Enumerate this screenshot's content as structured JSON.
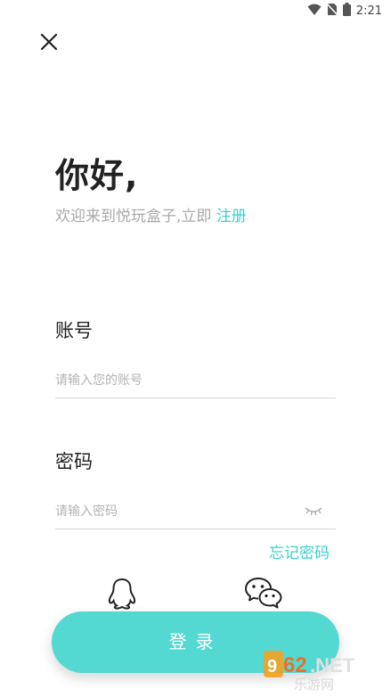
{
  "status_bar": {
    "time": "2:21",
    "icons": [
      "wifi-icon",
      "no-sim-icon",
      "battery-icon"
    ]
  },
  "close_icon": "close-icon",
  "greeting": {
    "title": "你好,",
    "welcome_prefix": "欢迎来到悦玩盒子,立即 ",
    "register_link": "注册"
  },
  "account": {
    "label": "账号",
    "placeholder": "请输入您的账号",
    "value": ""
  },
  "password": {
    "label": "密码",
    "placeholder": "请输入密码",
    "value": "",
    "toggle_icon": "eye-closed-icon"
  },
  "forgot_password": "忘记密码",
  "social_login": [
    "qq-icon",
    "wechat-icon"
  ],
  "login_button": "登录",
  "watermark": {
    "brand": "962.NET",
    "subtitle": "乐游网"
  },
  "colors": {
    "accent": "#3ccfd0",
    "button": "#53d9d2",
    "placeholder": "#b3b3b3",
    "subtitle": "#a9a9a9"
  }
}
